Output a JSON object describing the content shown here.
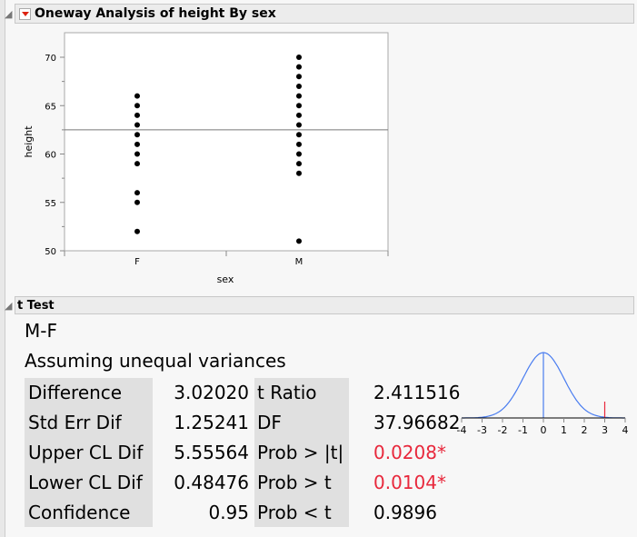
{
  "report": {
    "title": "Oneway Analysis of height By sex"
  },
  "chart_data": {
    "type": "scatter",
    "xlabel": "sex",
    "ylabel": "height",
    "categories": [
      "F",
      "M"
    ],
    "yticks": [
      "50",
      "55",
      "60",
      "65",
      "70"
    ],
    "ylim": [
      50,
      72
    ],
    "series": [
      {
        "name": "F",
        "values": [
          66,
          65,
          64,
          63,
          62,
          61,
          60,
          59,
          56,
          55,
          52
        ]
      },
      {
        "name": "M",
        "values": [
          70,
          69,
          68,
          67,
          66,
          65,
          64,
          63,
          62,
          61,
          60,
          59,
          58,
          51
        ]
      }
    ],
    "grand_mean": 62.5
  },
  "ttest": {
    "title": "t Test",
    "comparison": "M-F",
    "assumption": "Assuming unequal variances",
    "rows": [
      {
        "l1": "Difference",
        "v1": "3.02020",
        "l2": "t Ratio",
        "v2": "2.411516",
        "sig": false
      },
      {
        "l1": "Std Err Dif",
        "v1": "1.25241",
        "l2": "DF",
        "v2": "37.96682",
        "sig": false
      },
      {
        "l1": "Upper CL Dif",
        "v1": "5.55564",
        "l2": "Prob > |t|",
        "v2": "0.0208*",
        "sig": true
      },
      {
        "l1": "Lower CL Dif",
        "v1": "0.48476",
        "l2": "Prob > t",
        "v2": "0.0104*",
        "sig": true
      },
      {
        "l1": "Confidence",
        "v1": "0.95",
        "l2": "Prob < t",
        "v2": "0.9896",
        "sig": false
      }
    ],
    "dist": {
      "xticks": [
        "-4",
        "-3",
        "-2",
        "-1",
        "0",
        "1",
        "2",
        "3",
        "4"
      ],
      "marker": 3,
      "curve_color": "#4a7df0",
      "marker_color": "#e8283c"
    }
  }
}
